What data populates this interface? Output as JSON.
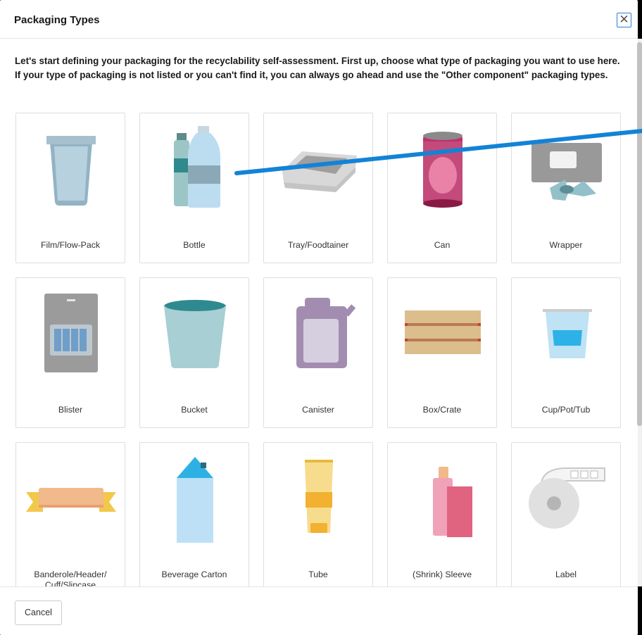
{
  "dialog": {
    "title": "Packaging Types",
    "close_icon": "close-icon",
    "intro": "Let's start defining your packaging for the recyclability self-assessment. First up, choose what type of packaging you want to use here. If your type of packaging is not listed or you can't find it, you can always go ahead and use the \"Other component\" packaging types."
  },
  "packaging_types": [
    {
      "label": "Film/Flow-Pack",
      "icon": "film-flow-pack-icon"
    },
    {
      "label": "Bottle",
      "icon": "bottle-icon"
    },
    {
      "label": "Tray/Foodtainer",
      "icon": "tray-icon"
    },
    {
      "label": "Can",
      "icon": "can-icon"
    },
    {
      "label": "Wrapper",
      "icon": "wrapper-icon"
    },
    {
      "label": "Blister",
      "icon": "blister-icon"
    },
    {
      "label": "Bucket",
      "icon": "bucket-icon"
    },
    {
      "label": "Canister",
      "icon": "canister-icon"
    },
    {
      "label": "Box/Crate",
      "icon": "box-crate-icon"
    },
    {
      "label": "Cup/Pot/Tub",
      "icon": "cup-pot-tub-icon"
    },
    {
      "label": "Banderole/Header/\nCuff/Slipcase",
      "icon": "banderole-icon"
    },
    {
      "label": "Beverage Carton",
      "icon": "beverage-carton-icon"
    },
    {
      "label": "Tube",
      "icon": "tube-icon"
    },
    {
      "label": "(Shrink) Sleeve",
      "icon": "sleeve-icon"
    },
    {
      "label": "Label",
      "icon": "label-icon"
    }
  ],
  "footer": {
    "cancel_label": "Cancel"
  },
  "annotation_line_color": "#1283d6"
}
